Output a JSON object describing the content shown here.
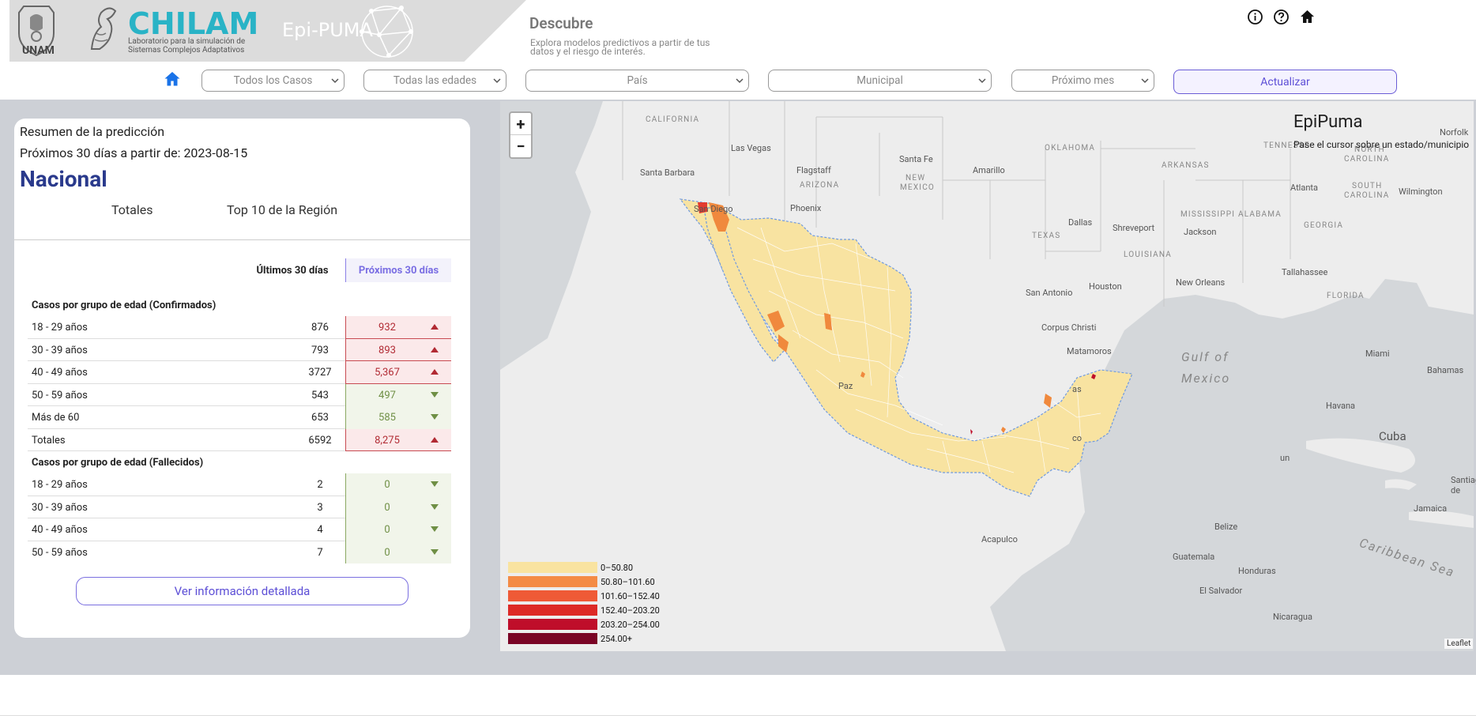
{
  "header": {
    "unam": "UNAM",
    "chilam_title": "CHILAM",
    "chilam_sub": "Laboratorio para la simulación de Sistemas Complejos Adaptativos",
    "epipuma": "Epi-PUMA",
    "page_title": "Descubre",
    "page_subtitle": "Explora modelos predictivos a partir de tus datos y el riesgo de interés.",
    "icons": [
      "info-icon",
      "help-icon",
      "home-icon"
    ]
  },
  "filters": {
    "cases": "Todos los Casos",
    "ages": "Todas las edades",
    "country": "País",
    "level": "Municipal",
    "period": "Próximo mes",
    "update": "Actualizar"
  },
  "summary": {
    "title": "Resumen de la predicción",
    "date": "Próximos 30 días a partir de: 2023-08-15",
    "region": "Nacional",
    "tab_totals": "Totales",
    "tab_top10": "Top 10 de la Región",
    "col_last": "Últimos 30 días",
    "col_next": "Próximos 30 días",
    "confirmed_header": "Casos por grupo de edad (Confirmados)",
    "confirmed": [
      {
        "label": "18 - 29 años",
        "last": "876",
        "next": "932",
        "trend": "up"
      },
      {
        "label": "30 - 39 años",
        "last": "793",
        "next": "893",
        "trend": "up"
      },
      {
        "label": "40 - 49 años",
        "last": "3727",
        "next": "5,367",
        "trend": "up"
      },
      {
        "label": "50 - 59 años",
        "last": "543",
        "next": "497",
        "trend": "down"
      },
      {
        "label": "Más de 60",
        "last": "653",
        "next": "585",
        "trend": "down"
      },
      {
        "label": "Totales",
        "last": "6592",
        "next": "8,275",
        "trend": "up"
      }
    ],
    "deceased_header": "Casos por grupo de edad (Fallecidos)",
    "deceased": [
      {
        "label": "18 - 29 años",
        "last": "2",
        "next": "0",
        "trend": "down"
      },
      {
        "label": "30 - 39 años",
        "last": "3",
        "next": "0",
        "trend": "down"
      },
      {
        "label": "40 - 49 años",
        "last": "4",
        "next": "0",
        "trend": "down"
      },
      {
        "label": "50 - 59 años",
        "last": "7",
        "next": "0",
        "trend": "down"
      }
    ],
    "detail_button": "Ver información detallada"
  },
  "map": {
    "zoom_in": "+",
    "zoom_out": "−",
    "info_title": "EpiPuma",
    "info_sub": "Pase el cursor sobre un estado/municipio",
    "attribution": "Leaflet",
    "labels": {
      "california": "CALIFORNIA",
      "las_vegas": "Las Vegas",
      "santa_barbara": "Santa Barbara",
      "flagstaff": "Flagstaff",
      "arizona": "ARIZONA",
      "santa_fe": "Santa Fe",
      "new_mexico_1": "NEW",
      "new_mexico_2": "MEXICO",
      "amarillo": "Amarillo",
      "oklahoma": "OKLAHOMA",
      "arkansas": "ARKANSAS",
      "tennessee": "TENNESSE",
      "norfolk": "Norfolk",
      "north_carolina_1": "NORTH",
      "north_carolina_2": "CAROLINA",
      "south_carolina_1": "SOUTH",
      "south_carolina_2": "CAROLINA",
      "atlanta": "Atlanta",
      "wilmington": "Wilmington",
      "phoenix": "Phoenix",
      "san_diego": "San Diego",
      "dallas": "Dallas",
      "shreveport": "Shreveport",
      "jackson": "Jackson",
      "mississippi": "MISSISSIPPI",
      "alabama": "ALABAMA",
      "georgia": "GEORGIA",
      "texas": "TEXAS",
      "louisiana": "LOUISIANA",
      "san_antonio": "San Antonio",
      "houston": "Houston",
      "new_orleans": "New Orleans",
      "tallahassee": "Tallahassee",
      "florida": "FLORIDA",
      "corpus_christi": "Corpus Christi",
      "matamoros": "Matamoros",
      "gulf_1": "Gulf of",
      "gulf_2": "Mexico",
      "miami": "Miami",
      "bahamas": "Bahamas",
      "havana": "Havana",
      "cuba": "Cuba",
      "santiago": "Santiago de",
      "jamaica": "Jamaica",
      "caribbean": "Caribbean Sea",
      "belize": "Belize",
      "guatemala": "Guatemala",
      "honduras": "Honduras",
      "el_salvador": "El Salvador",
      "nicaragua": "Nicaragua",
      "acapulco": "Acapulco",
      "paz": "Paz",
      "as": "as",
      "co": "co",
      "un": "un"
    },
    "legend": [
      {
        "label": "0–50.80",
        "color": "#f9e3a0"
      },
      {
        "label": "50.80–101.60",
        "color": "#f48b45"
      },
      {
        "label": "101.60–152.40",
        "color": "#ef5a36"
      },
      {
        "label": "152.40–203.20",
        "color": "#dd2a26"
      },
      {
        "label": "203.20–254.00",
        "color": "#bf0e2a"
      },
      {
        "label": "254.00+",
        "color": "#7a0425"
      }
    ]
  }
}
